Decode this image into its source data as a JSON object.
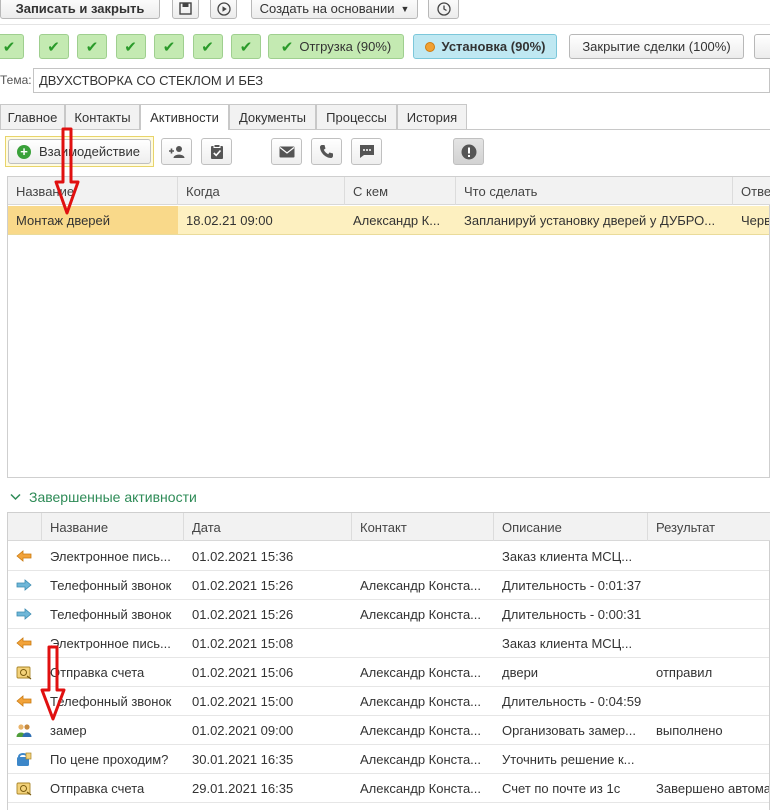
{
  "toolbar": {
    "save_close": "Записать и закрыть",
    "create_based": "Создать на основании"
  },
  "stages": {
    "completed_count": 7,
    "shipment": "Отгрузка (90%)",
    "installation": "Установка (90%)",
    "closing": "Закрытие сделки (100%)"
  },
  "subject": {
    "label": "Тема:",
    "value": "ДВУХСТВОРКА СО СТЕКЛОМ И БЕЗ"
  },
  "tabs": [
    "Главное",
    "Контакты",
    "Активности",
    "Документы",
    "Процессы",
    "История"
  ],
  "interaction_button": "Взаимодействие",
  "active_table": {
    "columns": [
      "Название",
      "Когда",
      "С кем",
      "Что сделать",
      "Отве"
    ],
    "rows": [
      [
        "Монтаж дверей",
        "18.02.21 09:00",
        "Александр К...",
        "Запланируй установку дверей у ДУБРО...",
        "Черв"
      ]
    ]
  },
  "completed_section": {
    "title": "Завершенные активности",
    "columns": [
      "Название",
      "Дата",
      "Контакт",
      "Описание",
      "Результат"
    ],
    "rows": [
      {
        "icon": "email-in-icon",
        "name": "Электронное пись...",
        "date": "01.02.2021 15:36",
        "contact": "",
        "desc": "Заказ клиента МСЦ...",
        "result": ""
      },
      {
        "icon": "call-out-icon",
        "name": "Телефонный звонок",
        "date": "01.02.2021 15:26",
        "contact": "Александр Конста...",
        "desc": "Длительность - 0:01:37",
        "result": ""
      },
      {
        "icon": "call-out-icon",
        "name": "Телефонный звонок",
        "date": "01.02.2021 15:26",
        "contact": "Александр Конста...",
        "desc": "Длительность - 0:00:31",
        "result": ""
      },
      {
        "icon": "email-in-icon",
        "name": "Электронное пись...",
        "date": "01.02.2021 15:08",
        "contact": "",
        "desc": "Заказ клиента МСЦ...",
        "result": ""
      },
      {
        "icon": "invoice-icon",
        "name": "Отправка счета",
        "date": "01.02.2021 15:06",
        "contact": "Александр Конста...",
        "desc": "двери",
        "result": "отправил"
      },
      {
        "icon": "email-in-icon",
        "name": "Телефонный звонок",
        "date": "01.02.2021 15:00",
        "contact": "Александр Конста...",
        "desc": "Длительность - 0:04:59",
        "result": ""
      },
      {
        "icon": "meeting-icon",
        "name": "замер",
        "date": "01.02.2021 09:00",
        "contact": "Александр Конста...",
        "desc": "Организовать замер...",
        "result": "выполнено"
      },
      {
        "icon": "phone-task-icon",
        "name": "По цене проходим?",
        "date": "30.01.2021 16:35",
        "contact": "Александр Конста...",
        "desc": "Уточнить решение к...",
        "result": ""
      },
      {
        "icon": "invoice-icon",
        "name": "Отправка счета",
        "date": "29.01.2021 16:35",
        "contact": "Александр Конста...",
        "desc": "Счет по почте из 1с",
        "result": "Завершено автомат"
      }
    ]
  },
  "colors": {
    "stage_done": "#c4eab2",
    "stage_current": "#bfe8f2",
    "selected_row": "#fdf0c0",
    "selected_cell": "#f9d98a",
    "section_title": "#2e8b57",
    "annotation_arrow": "#e01010"
  }
}
